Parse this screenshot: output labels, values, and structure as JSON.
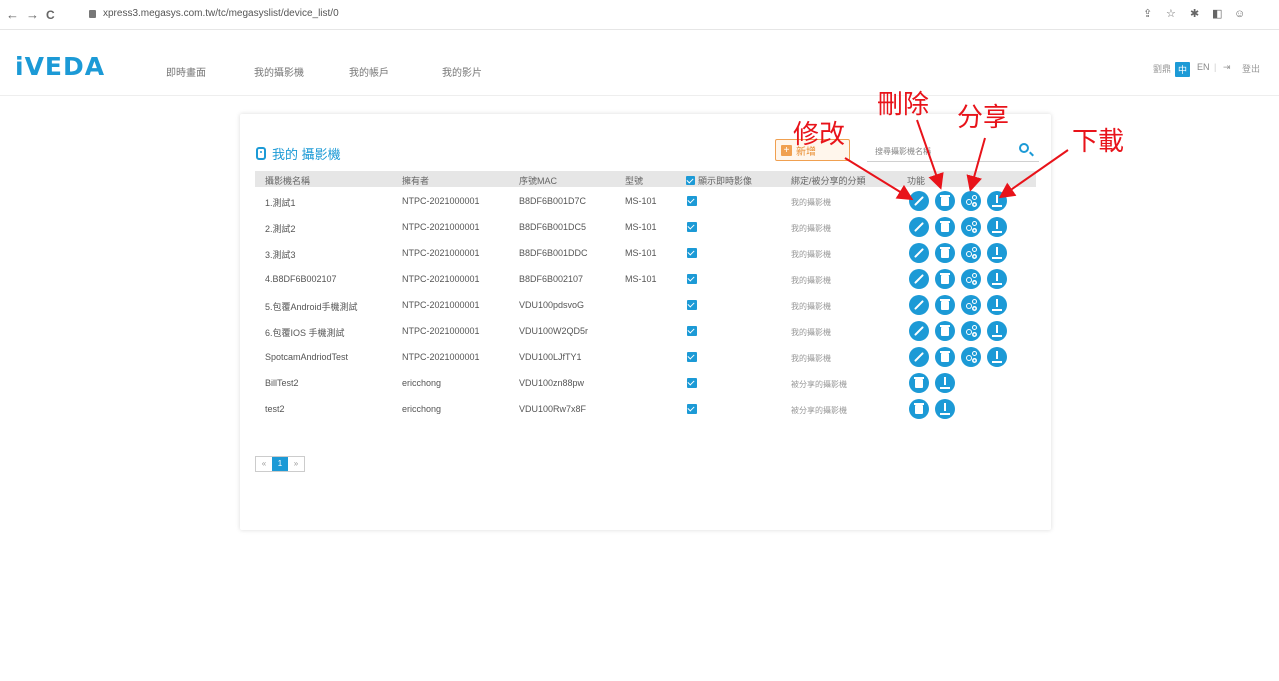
{
  "browser": {
    "back": "←",
    "forward": "→",
    "reload": "C",
    "url": "xpress3.megasys.com.tw/tc/megasyslist/device_list/0"
  },
  "header": {
    "logo": "iVEDA",
    "menu": [
      "即時畫面",
      "我的攝影機",
      "我的帳戶",
      "我的影片"
    ],
    "user": "劉鼎",
    "lang_active": "中",
    "lang_en": "EN",
    "logout": "登出"
  },
  "card": {
    "title": "我的 攝影機",
    "add_button": "新增",
    "search_placeholder": "搜尋攝影機名稱"
  },
  "table": {
    "headers": [
      "攝影機名稱",
      "擁有者",
      "序號MAC",
      "型號",
      "顯示即時影像",
      "綁定/被分享的分類",
      "功能"
    ],
    "rows": [
      {
        "name": "1.測試1",
        "owner": "NTPC-2021000001",
        "mac": "B8DF6B001D7C",
        "model": "MS-101",
        "category": "我的攝影機",
        "actions": [
          "edit",
          "delete",
          "share",
          "download"
        ]
      },
      {
        "name": "2.測試2",
        "owner": "NTPC-2021000001",
        "mac": "B8DF6B001DC5",
        "model": "MS-101",
        "category": "我的攝影機",
        "actions": [
          "edit",
          "delete",
          "share",
          "download"
        ]
      },
      {
        "name": "3.測試3",
        "owner": "NTPC-2021000001",
        "mac": "B8DF6B001DDC",
        "model": "MS-101",
        "category": "我的攝影機",
        "actions": [
          "edit",
          "delete",
          "share",
          "download"
        ]
      },
      {
        "name": "4.B8DF6B002107",
        "owner": "NTPC-2021000001",
        "mac": "B8DF6B002107",
        "model": "MS-101",
        "category": "我的攝影機",
        "actions": [
          "edit",
          "delete",
          "share",
          "download"
        ]
      },
      {
        "name": "5.包覆Android手機測試",
        "owner": "NTPC-2021000001",
        "mac": "VDU100pdsvoG",
        "model": "",
        "category": "我的攝影機",
        "actions": [
          "edit",
          "delete",
          "share",
          "download"
        ]
      },
      {
        "name": "6.包覆IOS 手機測試",
        "owner": "NTPC-2021000001",
        "mac": "VDU100W2QD5r",
        "model": "",
        "category": "我的攝影機",
        "actions": [
          "edit",
          "delete",
          "share",
          "download"
        ]
      },
      {
        "name": "SpotcamAndriodTest",
        "owner": "NTPC-2021000001",
        "mac": "VDU100LJfTY1",
        "model": "",
        "category": "我的攝影機",
        "actions": [
          "edit",
          "delete",
          "share",
          "download"
        ]
      },
      {
        "name": "BillTest2",
        "owner": "ericchong",
        "mac": "VDU100zn88pw",
        "model": "",
        "category": "被分享的攝影機",
        "actions": [
          "delete",
          "download"
        ]
      },
      {
        "name": "test2",
        "owner": "ericchong",
        "mac": "VDU100Rw7x8F",
        "model": "",
        "category": "被分享的攝影機",
        "actions": [
          "delete",
          "download"
        ]
      }
    ]
  },
  "pagination": {
    "prev": "«",
    "current": "1",
    "next": "»"
  },
  "annotations": {
    "edit": "修改",
    "delete": "刪除",
    "share": "分享",
    "download": "下載",
    "color": "#e8131a"
  },
  "colors": {
    "accent": "#1c9ad6",
    "add_orange": "#f0a050"
  }
}
